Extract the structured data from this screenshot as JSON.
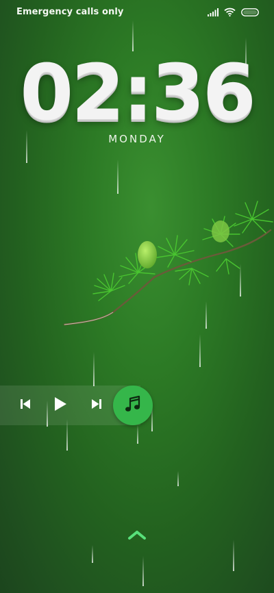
{
  "status_bar": {
    "carrier_text": "Emergency calls only",
    "icons": [
      "signal-icon",
      "wifi-icon",
      "battery-icon"
    ]
  },
  "lock_screen": {
    "time": "02:36",
    "day": "MONDAY"
  },
  "music_widget": {
    "controls": [
      "previous-icon",
      "play-icon",
      "next-icon"
    ],
    "app_icon": "music-note-icon",
    "accent_color": "#35b64a"
  },
  "unlock": {
    "icon": "chevron-up-icon",
    "color": "#58e07a"
  }
}
